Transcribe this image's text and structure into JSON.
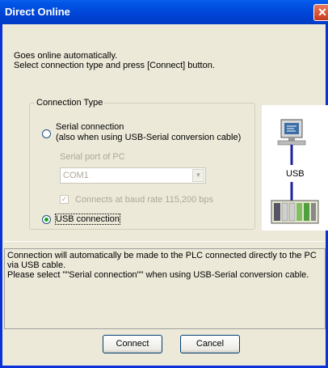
{
  "window": {
    "title": "Direct Online",
    "close_glyph": "✕"
  },
  "intro": {
    "line1": "Goes online automatically.",
    "line2": "Select connection type and press [Connect] button."
  },
  "connection_type": {
    "group_label": "Connection Type",
    "serial": {
      "label_line1": "Serial connection",
      "label_line2": "(also when using USB-Serial conversion cable)",
      "selected": false,
      "port_label": "Serial port of PC",
      "port_value": "COM1",
      "baud_checkbox_label": "Connects at baud rate 115,200 bps",
      "baud_checked": true,
      "enabled": false
    },
    "usb": {
      "label": "USB connection",
      "selected": true
    }
  },
  "diagram": {
    "cable_label": "USB",
    "pc_icon": "pc-monitor-icon",
    "plc_icon": "plc-rack-icon"
  },
  "info": {
    "line1": "Connection will automatically be made to the PLC connected directly to the PC via USB cable.",
    "line2": "Please select \"\"Serial connection\"\" when using USB-Serial conversion cable."
  },
  "buttons": {
    "connect": "Connect",
    "cancel": "Cancel"
  },
  "colors": {
    "titlebar": "#0055e5",
    "dialog_bg": "#ece9d8",
    "usb_line": "#1f1fa0"
  }
}
